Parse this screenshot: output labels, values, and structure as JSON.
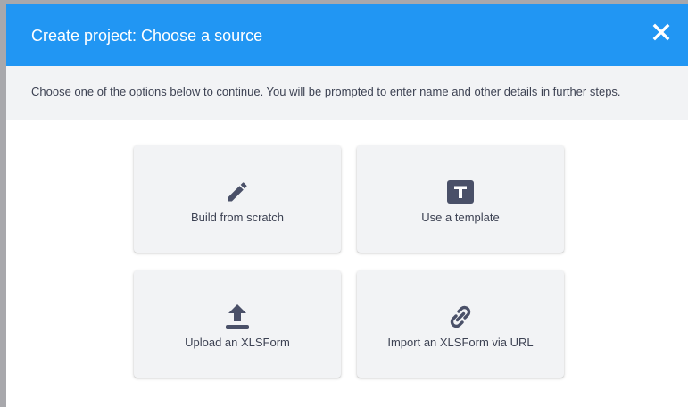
{
  "header": {
    "title": "Create project: Choose a source",
    "close_icon": "close-icon"
  },
  "intro": {
    "text": "Choose one of the options below to continue. You will be prompted to enter name and other details in further steps."
  },
  "options": [
    {
      "label": "Build from scratch",
      "icon": "pencil-icon"
    },
    {
      "label": "Use a template",
      "icon": "template-icon"
    },
    {
      "label": "Upload an XLSForm",
      "icon": "upload-icon"
    },
    {
      "label": "Import an XLSForm via URL",
      "icon": "link-icon"
    }
  ],
  "colors": {
    "header_bg": "#2196f3",
    "card_bg": "#f2f3f5",
    "icon": "#4a5068",
    "text": "#3d4253"
  }
}
